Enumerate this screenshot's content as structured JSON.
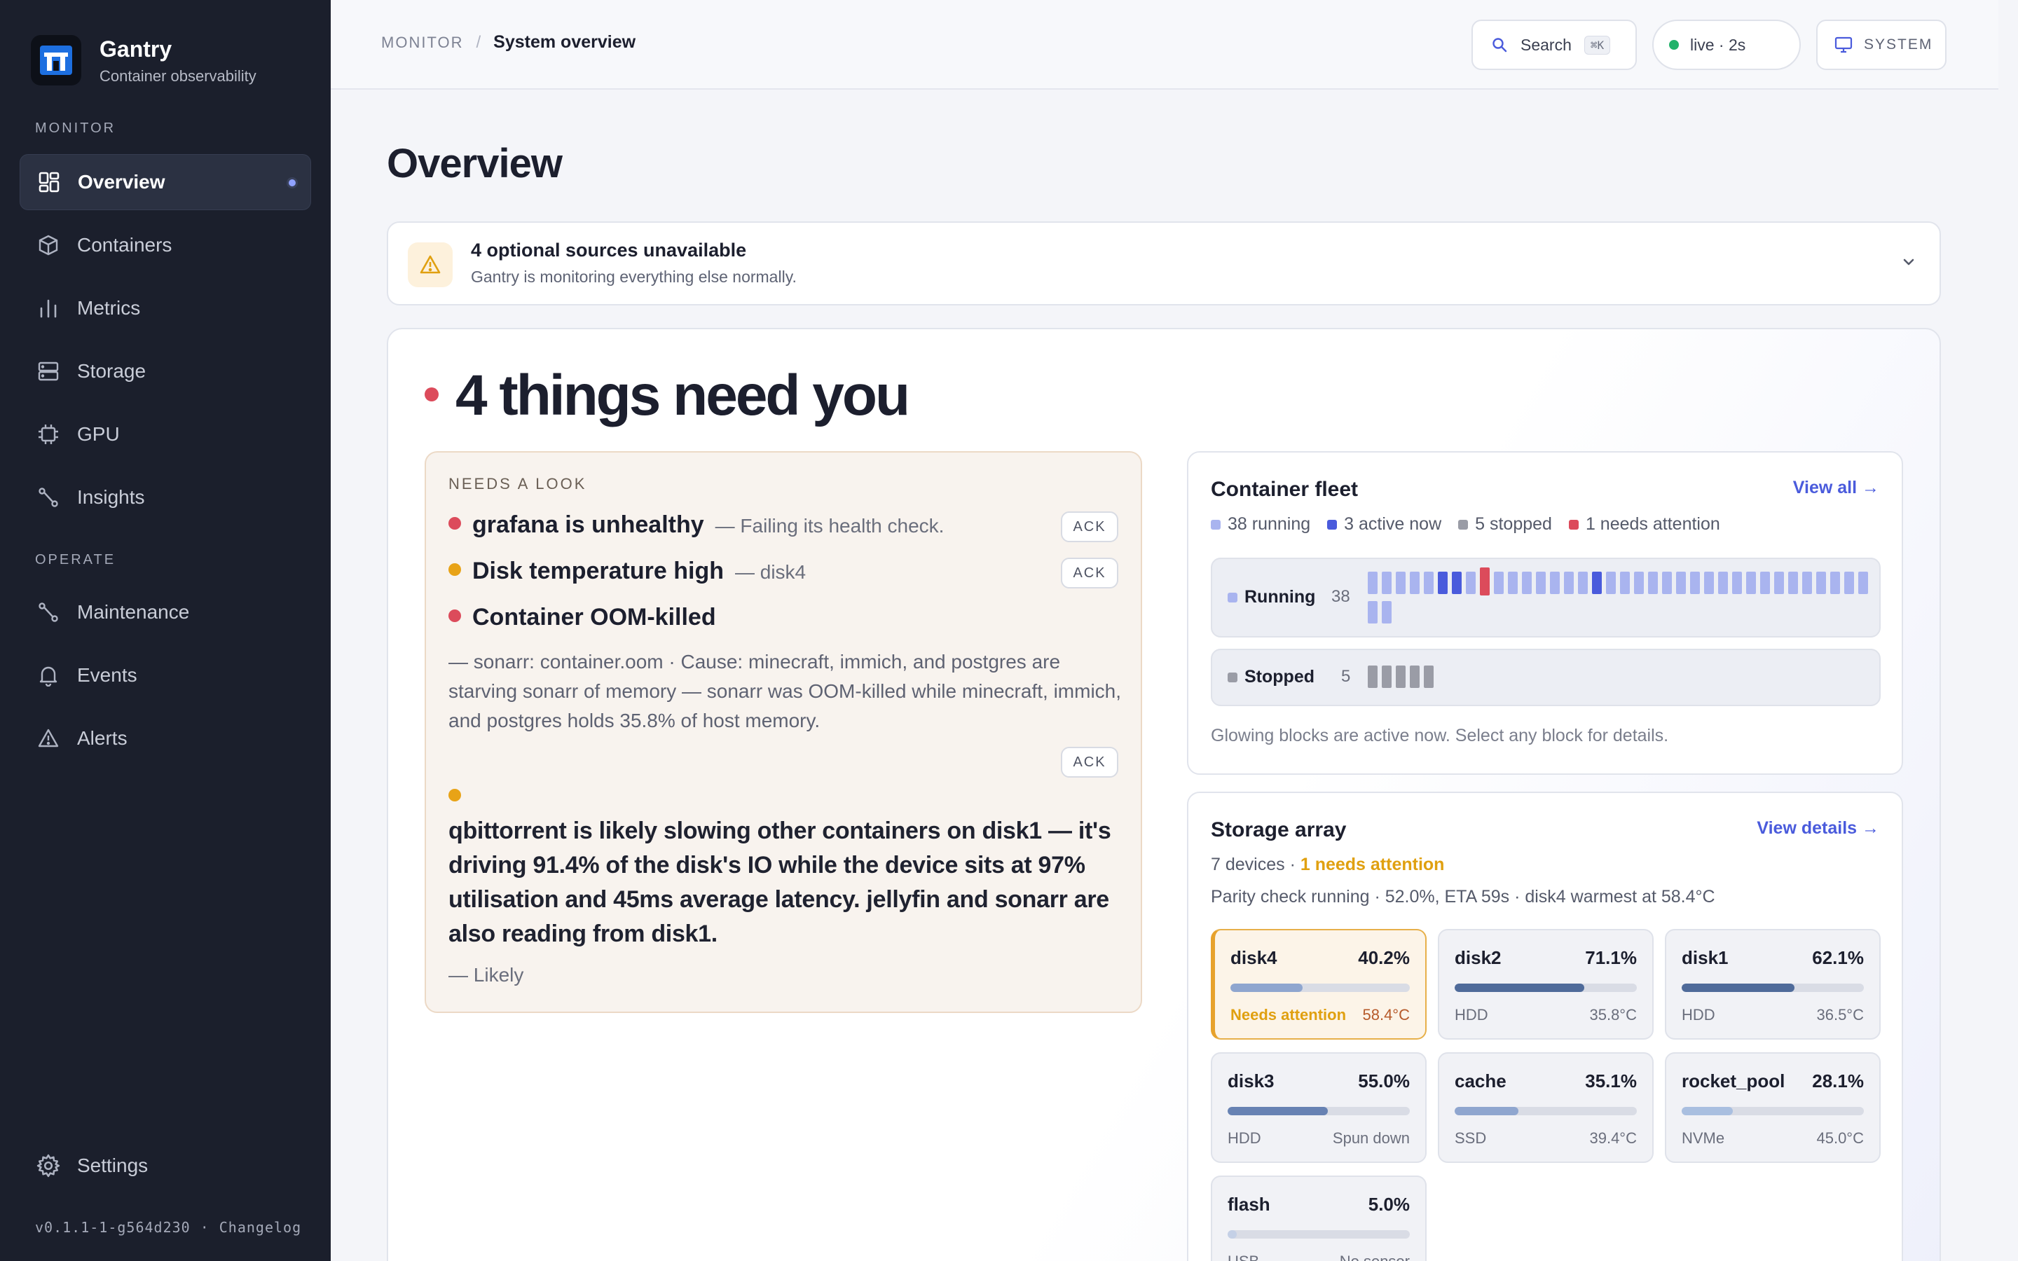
{
  "app": {
    "name": "Gantry",
    "tagline": "Container observability",
    "version": "v0.1.1-1-g564d230",
    "changelog": "Changelog"
  },
  "sidebar": {
    "sections": [
      {
        "label": "MONITOR",
        "items": [
          {
            "label": "Overview",
            "icon": "grid-icon",
            "active": true
          },
          {
            "label": "Containers",
            "icon": "box-icon"
          },
          {
            "label": "Metrics",
            "icon": "bar-chart-icon"
          },
          {
            "label": "Storage",
            "icon": "server-icon"
          },
          {
            "label": "GPU",
            "icon": "chip-icon"
          },
          {
            "label": "Insights",
            "icon": "route-icon"
          }
        ]
      },
      {
        "label": "OPERATE",
        "items": [
          {
            "label": "Maintenance",
            "icon": "route-icon"
          },
          {
            "label": "Events",
            "icon": "bell-icon"
          },
          {
            "label": "Alerts",
            "icon": "warning-icon"
          }
        ]
      }
    ],
    "settings": "Settings"
  },
  "topbar": {
    "breadcrumb": [
      "MONITOR",
      "System overview"
    ],
    "search": {
      "label": "Search",
      "shortcut": "⌘K"
    },
    "live": "live · 2s",
    "theme": "SYSTEM"
  },
  "page": {
    "title": "Overview"
  },
  "banner": {
    "title": "4 optional sources unavailable",
    "subtitle": "Gantry is monitoring everything else normally."
  },
  "attention": {
    "headline": "4 things need you",
    "section_label": "NEEDS A LOOK",
    "ack_label": "ACK",
    "issues": [
      {
        "title": "grafana is unhealthy",
        "detail": "— Failing its health check.",
        "color": "#dc4b5b"
      },
      {
        "title": "Disk temperature high",
        "detail": "— disk4",
        "color": "#e8a317"
      },
      {
        "title": "Container OOM-killed",
        "detail": "— sonarr: container.oom · Cause: minecraft, immich, and postgres are starving sonarr of memory — sonarr was OOM-killed while minecraft, immich, and postgres holds 35.8% of host memory.",
        "color": "#dc4b5b"
      },
      {
        "title": "qbittorrent is likely slowing other containers on disk1 — it's driving 91.4% of the disk's IO while the device sits at 97% utilisation and 45ms average latency. jellyfin and sonarr are also reading from disk1.",
        "detail": "— Likely",
        "color": "#e8a317"
      }
    ]
  },
  "fleet": {
    "title": "Container fleet",
    "link": "View all →",
    "legend": [
      {
        "label": "38 running",
        "color": "#a9b4ef"
      },
      {
        "label": "3 active now",
        "color": "#4a5bdc"
      },
      {
        "label": "5 stopped",
        "color": "#9a9ca6"
      },
      {
        "label": "1 needs attention",
        "color": "#dc4b5b"
      }
    ],
    "running": {
      "label": "Running",
      "count": "38"
    },
    "stopped": {
      "label": "Stopped",
      "count": "5"
    },
    "note": "Glowing blocks are active now. Select any block for details."
  },
  "storage": {
    "title": "Storage array",
    "link": "View details →",
    "devices": "7 devices",
    "attention": "1 needs attention",
    "status": "Parity check running · 52.0%, ETA 59s · disk4 warmest at 58.4°C",
    "disks": [
      {
        "name": "disk4",
        "pct": "40.2%",
        "value": 40.2,
        "type": "Needs attention",
        "temp": "58.4°C",
        "alert": true,
        "color": "#8fa6cf"
      },
      {
        "name": "disk2",
        "pct": "71.1%",
        "value": 71.1,
        "type": "HDD",
        "temp": "35.8°C",
        "color": "#4f6b9a"
      },
      {
        "name": "disk1",
        "pct": "62.1%",
        "value": 62.1,
        "type": "HDD",
        "temp": "36.5°C",
        "color": "#4f6b9a"
      },
      {
        "name": "disk3",
        "pct": "55.0%",
        "value": 55.0,
        "type": "HDD",
        "temp": "Spun down",
        "color": "#6782b3"
      },
      {
        "name": "cache",
        "pct": "35.1%",
        "value": 35.1,
        "type": "SSD",
        "temp": "39.4°C",
        "color": "#8fa6cf"
      },
      {
        "name": "rocket_pool",
        "pct": "28.1%",
        "value": 28.1,
        "type": "NVMe",
        "temp": "45.0°C",
        "color": "#a9bfe0"
      },
      {
        "name": "flash",
        "pct": "5.0%",
        "value": 5.0,
        "type": "USB",
        "temp": "No sensor",
        "color": "#c4d0e6"
      }
    ]
  }
}
